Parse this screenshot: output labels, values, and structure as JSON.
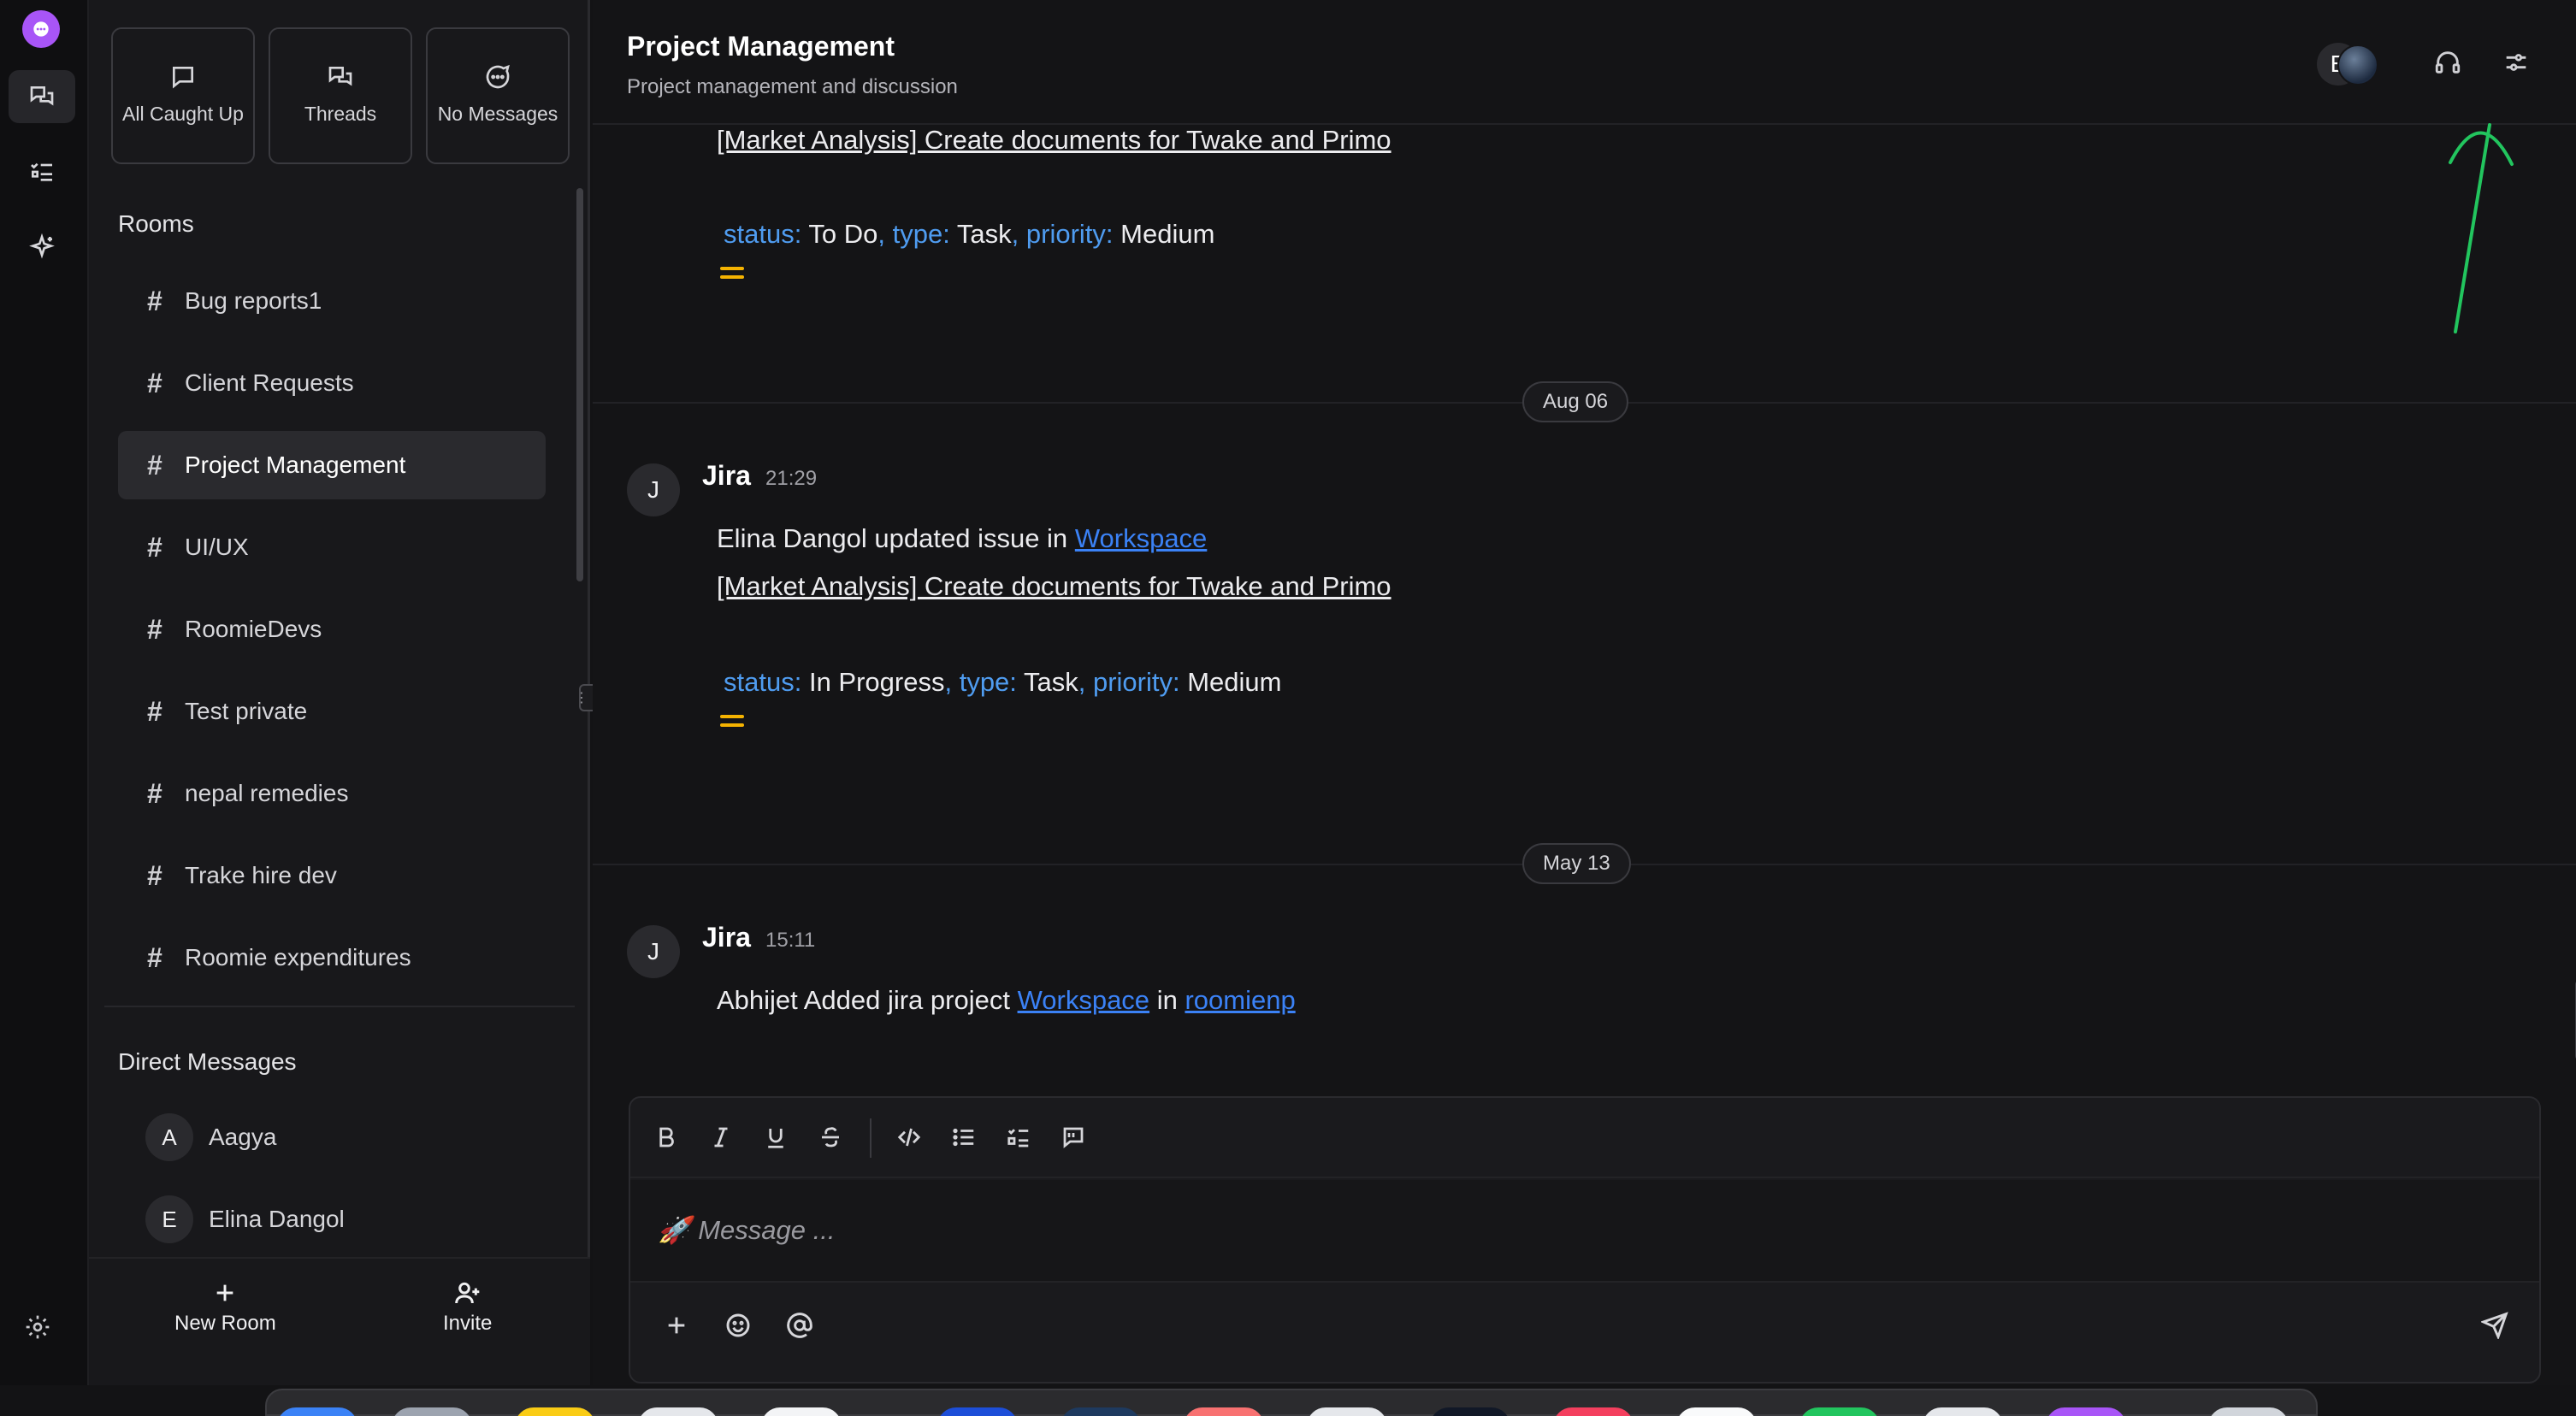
{
  "rail": {
    "items": [
      "chat-icon",
      "tasks-icon",
      "sparkle-icon"
    ],
    "settings_icon": "gear-icon"
  },
  "quick_cards": [
    {
      "icon": "chat-bubble-icon",
      "label": "All Caught Up"
    },
    {
      "icon": "threads-icon",
      "label": "Threads"
    },
    {
      "icon": "message-circle-icon",
      "label": "No Messages"
    }
  ],
  "rooms": {
    "title": "Rooms",
    "items": [
      {
        "label": "Bug reports1",
        "active": false
      },
      {
        "label": "Client Requests",
        "active": false
      },
      {
        "label": "Project Management",
        "active": true
      },
      {
        "label": "UI/UX",
        "active": false
      },
      {
        "label": "RoomieDevs",
        "active": false
      },
      {
        "label": "Test private",
        "active": false
      },
      {
        "label": "nepal remedies",
        "active": false
      },
      {
        "label": "Trake hire dev",
        "active": false
      },
      {
        "label": "Roomie expenditures",
        "active": false
      }
    ]
  },
  "direct_messages": {
    "title": "Direct Messages",
    "items": [
      {
        "initial": "A",
        "label": "Aagya"
      },
      {
        "initial": "E",
        "label": "Elina Dangol"
      }
    ]
  },
  "footer": {
    "new_room": "New Room",
    "invite": "Invite"
  },
  "header": {
    "title": "Project Management",
    "subtitle": "Project management and discussion",
    "avatar_initial": "E"
  },
  "feed": {
    "top": {
      "link": "[Market Analysis] Create documents for Twake and Primo",
      "status_key": "status:",
      "status": "To Do",
      "type_key": "type:",
      "type": "Task",
      "priority_key": "priority:",
      "priority": "Medium"
    },
    "day1": "Aug 06",
    "msg1": {
      "initial": "J",
      "author": "Jira",
      "time": "21:29",
      "text": "Elina Dangol updated issue in",
      "workspace_link": "Workspace",
      "link": "[Market Analysis] Create documents for Twake and Primo",
      "status_key": "status:",
      "status": "In Progress",
      "type_key": "type:",
      "type": "Task",
      "priority_key": "priority:",
      "priority": "Medium"
    },
    "day2": "May 13",
    "msg2": {
      "initial": "J",
      "author": "Jira",
      "time": "15:11",
      "text": "Abhijet Added jira project",
      "workspace_link": "Workspace",
      "in": "in",
      "org_link": "roomienp"
    }
  },
  "composer": {
    "placeholder": "🚀 Message ...",
    "tools": [
      "bold-icon",
      "italic-icon",
      "underline-icon",
      "strikethrough-icon",
      "code-icon",
      "bullet-list-icon",
      "checklist-icon",
      "quote-icon"
    ]
  },
  "accent_colors": {
    "link": "#3b82f6",
    "meta_key": "#4f9cf0",
    "priority_medium": "#f5b301",
    "brand": "#a855f7",
    "annotation_arrow": "#22c55e"
  }
}
